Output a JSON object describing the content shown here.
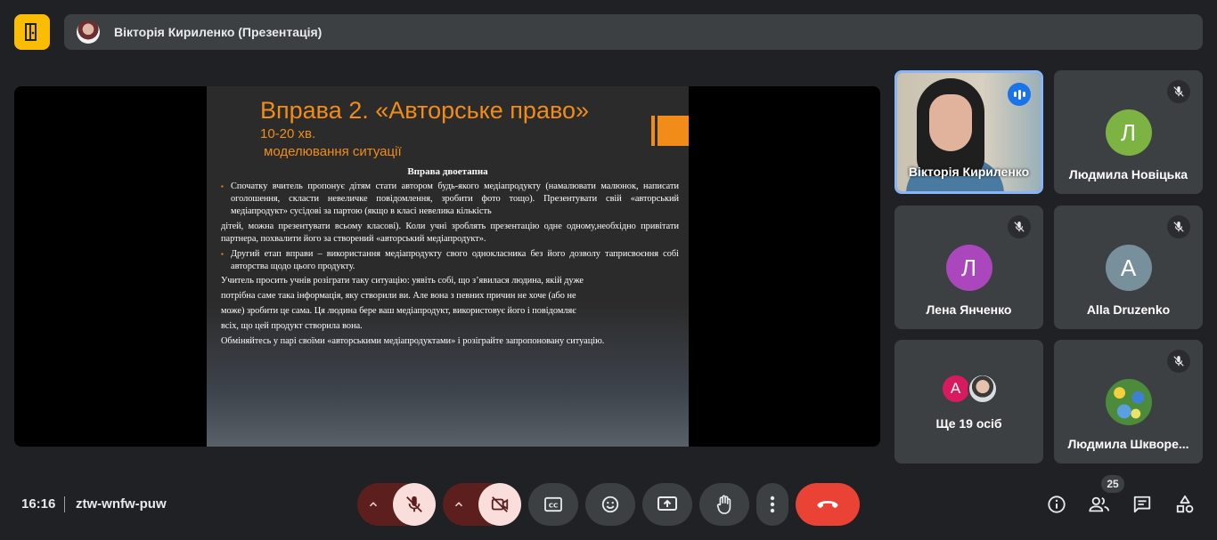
{
  "header": {
    "presenter_label": "Вікторія Кириленко (Презентація)"
  },
  "slide": {
    "title": "Вправа 2. «Авторське право»",
    "subtitle_1": "10-20 хв.",
    "subtitle_2": "моделювання ситуації",
    "heading": "Вправа двоетапна",
    "para_1": "Спочатку вчитель пропонує дітям стати автором будь-якого медіапродукту (намалювати малюнок, написати оголошення, скласти невеличке повідомлення, зробити фото тощо). Презентувати свій «авторський медіапродукт» сусідові за партою (якщо в класі невелика кількість",
    "para_2": "дітей, можна презентувати всьому класові). Коли учні зроблять презентацію одне одному,необхідно привітати партнера, похвалити його за створений «авторський медіапродукт».",
    "para_3": "Другий етап вправи – використання медіапродукту свого однокласника без його дозволу таприсвоєння собі авторства щодо цього продукту.",
    "line_4": "Учитель просить учнів розіграти таку ситуацію: уявіть собі, що з’явилася людина, якій дуже",
    "line_5": "потрібна саме така інформація, яку створили ви. Але вона з певних причин не хоче (або не",
    "line_6": "може) зробити це сама. Ця людина бере ваш медіапродукт, використовує його і повідомляє",
    "line_7": "всіх, що цей продукт створила вона.",
    "line_8": "Обміняйтесь у парі своїми «авторськими медіапродуктами» і розіграйте запропоновану ситуацію."
  },
  "participants": [
    {
      "name": "Вікторія Кириленко",
      "state": "speaking"
    },
    {
      "name": "Людмила Новіцька",
      "initial": "Л",
      "color": "#7cb342",
      "state": "muted"
    },
    {
      "name": "Лена Янченко",
      "initial": "Л",
      "color": "#ab47bc",
      "state": "muted"
    },
    {
      "name": "Alla Druzenko",
      "initial": "A",
      "color": "#78909c",
      "state": "muted"
    },
    {
      "name": "Людмила Шкворе...",
      "state": "muted"
    }
  ],
  "others": {
    "label": "Ще 19 осіб",
    "initial": "A",
    "color": "#d81b60"
  },
  "footer": {
    "time": "16:16",
    "meeting_code": "ztw-wnfw-puw",
    "participant_count": "25"
  },
  "colors": {
    "accent_orange": "#f28c18",
    "end_call": "#ea4335",
    "speaking": "#1a73e8"
  }
}
